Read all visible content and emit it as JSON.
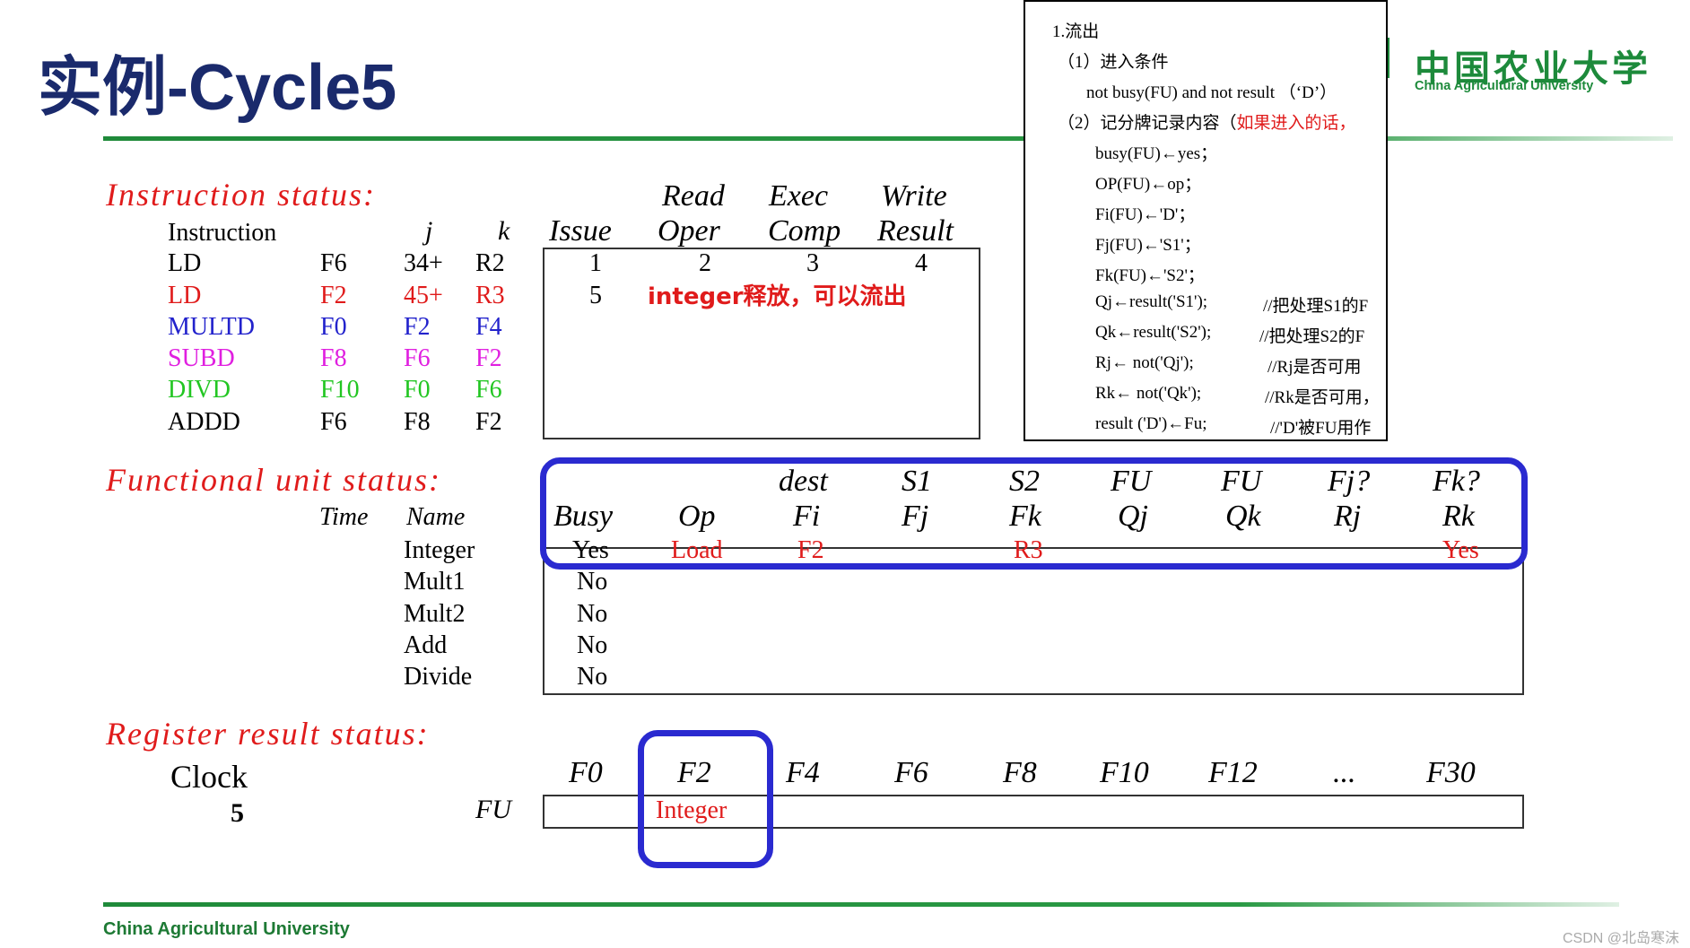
{
  "slide_title": "实例-Cycle5",
  "logo": {
    "cn": "中国农业大学",
    "en": "China Agricultural University"
  },
  "instruction_status": {
    "section_title": "Instruction status:",
    "headers": {
      "instruction": "Instruction",
      "j": "j",
      "k": "k",
      "issue": "Issue",
      "read_top": "Read",
      "read_bot": "Oper",
      "exec_top": "Exec",
      "exec_bot": "Comp",
      "write_top": "Write",
      "write_bot": "Result"
    },
    "rows": [
      {
        "op": "LD",
        "d": "F6",
        "j": "34+",
        "k": "R2",
        "issue": "1",
        "read": "2",
        "exec": "3",
        "write": "4"
      },
      {
        "op": "LD",
        "d": "F2",
        "j": "45+",
        "k": "R3",
        "issue": "5",
        "note": "integer释放，可以流出"
      },
      {
        "op": "MULTD",
        "d": "F0",
        "j": "F2",
        "k": "F4"
      },
      {
        "op": "SUBD",
        "d": "F8",
        "j": "F6",
        "k": "F2"
      },
      {
        "op": "DIVD",
        "d": "F10",
        "j": "F0",
        "k": "F6"
      },
      {
        "op": "ADDD",
        "d": "F6",
        "j": "F8",
        "k": "F2"
      }
    ]
  },
  "functional_unit_status": {
    "section_title": "Functional unit status:",
    "headers_top": {
      "dest": "dest",
      "s1": "S1",
      "s2": "S2",
      "fu1": "FU",
      "fu2": "FU",
      "fjq": "Fj?",
      "fkq": "Fk?"
    },
    "headers_bot": {
      "time": "Time",
      "name": "Name",
      "busy": "Busy",
      "op": "Op",
      "fi": "Fi",
      "fj": "Fj",
      "fk": "Fk",
      "qj": "Qj",
      "qk": "Qk",
      "rj": "Rj",
      "rk": "Rk"
    },
    "rows": [
      {
        "name": "Integer",
        "busy": "Yes",
        "op": "Load",
        "fi": "F2",
        "fk": "R3",
        "rk": "Yes"
      },
      {
        "name": "Mult1",
        "busy": "No"
      },
      {
        "name": "Mult2",
        "busy": "No"
      },
      {
        "name": "Add",
        "busy": "No"
      },
      {
        "name": "Divide",
        "busy": "No"
      }
    ]
  },
  "register_result_status": {
    "section_title": "Register result status:",
    "clock_label": "Clock",
    "clock_value": "5",
    "fu_label": "FU",
    "registers": [
      "F0",
      "F2",
      "F4",
      "F6",
      "F8",
      "F10",
      "F12",
      "...",
      "F30"
    ],
    "f2_value": "Integer"
  },
  "popup": {
    "l1": "1.流出",
    "l2": "（1）进入条件",
    "l3": "not busy(FU) and not result （‘D’）",
    "l4a": "（2）记分牌记录内容（",
    "l4b": "如果进入的话，",
    "l5": "busy(FU)←yes；",
    "l6": "OP(FU)←op；",
    "l7": "Fi(FU)←'D'；",
    "l8": "Fj(FU)←'S1'；",
    "l9": "Fk(FU)←'S2'；",
    "l10a": "Qj←result('S1');",
    "l10b": "//把处理S1的F",
    "l11a": "Qk←result('S2');",
    "l11b": "//把处理S2的F",
    "l12a": "Rj← not('Qj');",
    "l12b": "//Rj是否可用",
    "l13a": "Rk← not('Qk');",
    "l13b": "//Rk是否可用，",
    "l14a": "result ('D')←Fu;",
    "l14b": "//'D'被FU用作"
  },
  "footer": "China Agricultural University",
  "watermark": "CSDN @北岛寒沫"
}
